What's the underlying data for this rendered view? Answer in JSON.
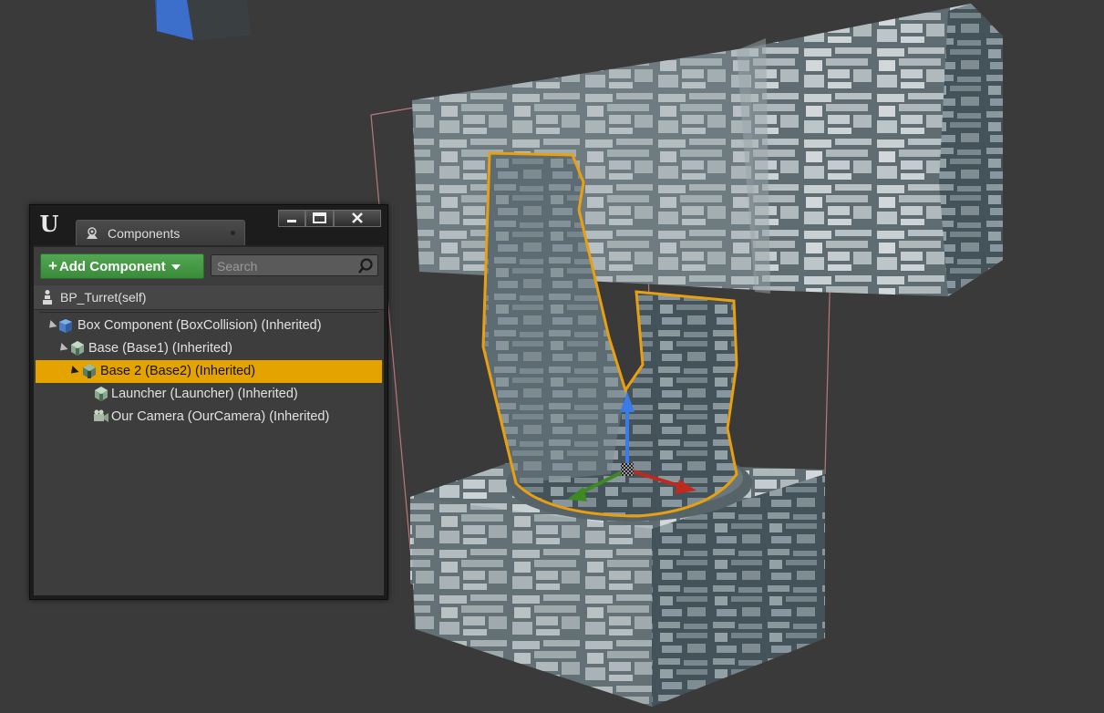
{
  "window": {
    "logo": "U",
    "tab": {
      "title": "Components",
      "icon": "components-icon"
    },
    "controls": [
      "minimize-icon",
      "maximize-icon",
      "close-icon"
    ]
  },
  "toolbar": {
    "add_component_label": "Add Component",
    "search_placeholder": "Search"
  },
  "self_item": {
    "label": "BP_Turret(self)",
    "icon": "actor-icon"
  },
  "tree": [
    {
      "label": "Box Component (BoxCollision) (Inherited)",
      "icon": "box-collision-icon",
      "expanded": true,
      "selected": false
    },
    {
      "label": "Base (Base1) (Inherited)",
      "icon": "static-mesh-icon",
      "expanded": true,
      "selected": false
    },
    {
      "label": "Base 2 (Base2) (Inherited)",
      "icon": "static-mesh-icon",
      "expanded": true,
      "selected": true
    },
    {
      "label": "Launcher (Launcher) (Inherited)",
      "icon": "static-mesh-icon",
      "expanded": false,
      "selected": false
    },
    {
      "label": "Our Camera (OurCamera) (Inherited)",
      "icon": "camera-icon",
      "expanded": false,
      "selected": false
    }
  ],
  "colors": {
    "viewport_bg": "#3a3a3a",
    "selection": "#e5a300",
    "add_button": "#45994a",
    "outline": "#e8a010",
    "bounds": "#b87880"
  }
}
